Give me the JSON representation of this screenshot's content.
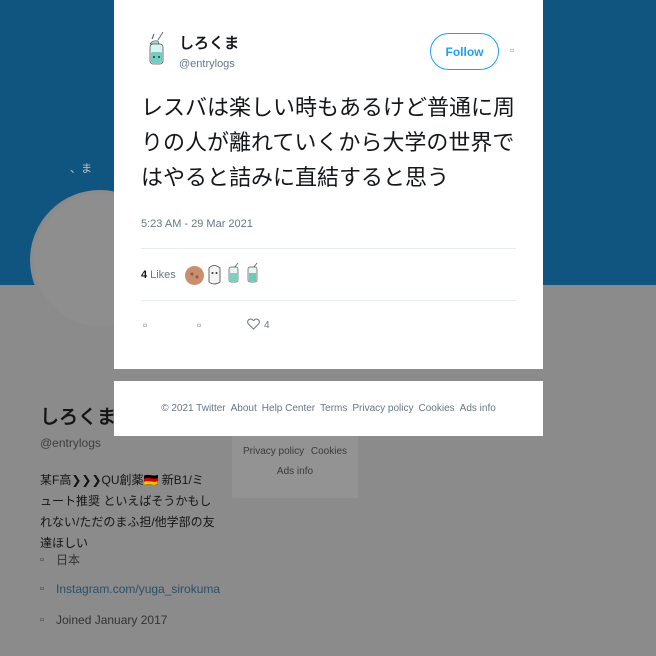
{
  "background_profile": {
    "avatar_text": "、ま",
    "name": "しろくま",
    "handle": "@entrylogs",
    "bio": "某F高❯❯❯QU創薬🇩🇪 新B1/ミュート推奨 といえばそうかもしれない/ただのまふ担/他学部の友達ほしい",
    "location": "日本",
    "link": "Instagram.com/yuga_sirokuma",
    "joined": "Joined January 2017",
    "location_icon": "location-icon",
    "link_icon": "link-icon",
    "calendar_icon": "calendar-icon",
    "footer_partial": {
      "row1": "Privacy policy",
      "row1b": "Cookies",
      "row2": "Ads info"
    }
  },
  "tweet": {
    "display_name": "しろくま",
    "handle": "@entrylogs",
    "follow_label": "Follow",
    "more_icon": "more-icon",
    "text": "レスバは楽しい時もあるけど普通に周りの人が離れていくから大学の世界ではやると詰みに直結すると思う",
    "timestamp": "5:23 AM - 29 Mar 2021",
    "likes_count": "4",
    "likes_label": "Likes",
    "likers": [
      "liker-avatar-1",
      "liker-avatar-2",
      "liker-avatar-3",
      "liker-avatar-4"
    ],
    "actions": {
      "reply_icon": "reply-icon",
      "retweet_icon": "retweet-icon",
      "like_icon": "heart-icon",
      "like_count": "4"
    }
  },
  "footer": {
    "links": [
      "© 2021 Twitter",
      "About",
      "Help Center",
      "Terms",
      "Privacy policy",
      "Cookies",
      "Ads info"
    ]
  },
  "colors": {
    "banner": "#10557f",
    "accent": "#1da1f2",
    "muted_text": "#657786"
  }
}
